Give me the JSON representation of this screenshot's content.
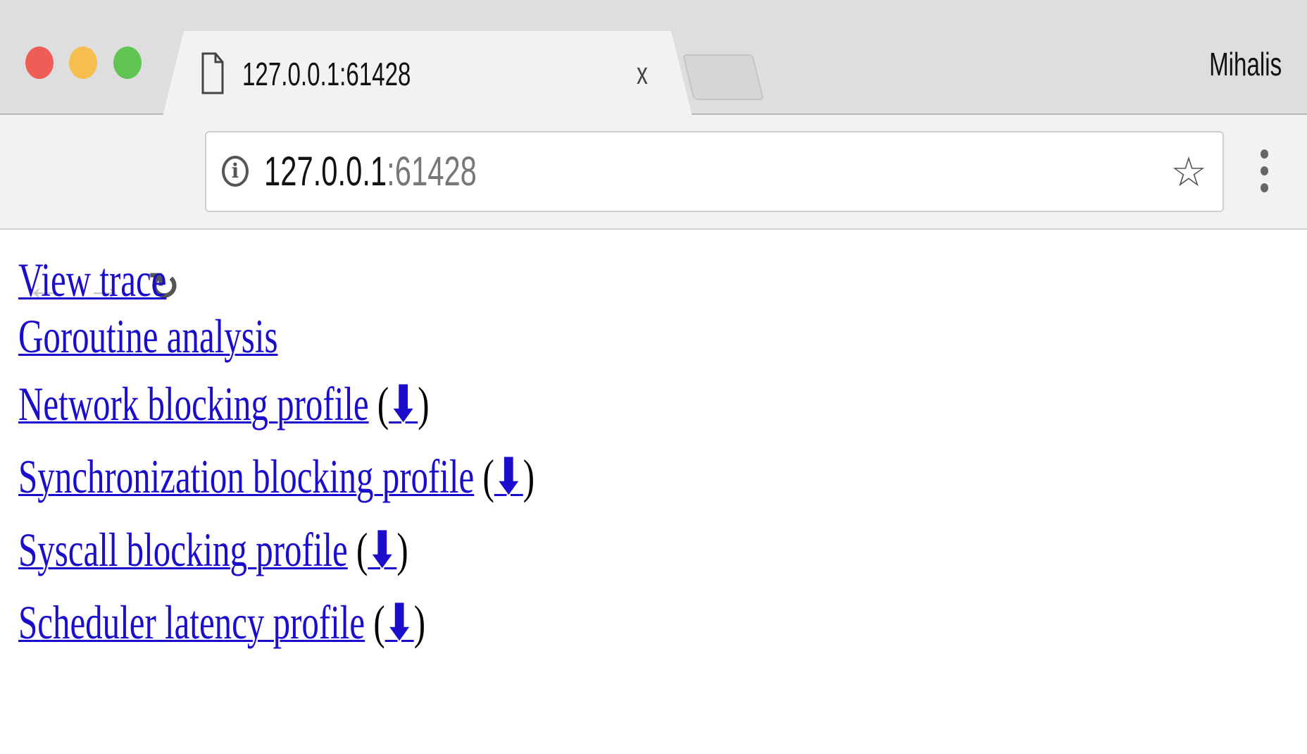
{
  "window": {
    "traffic_lights": {
      "close": "#ee5e57",
      "minimize": "#f6be4f",
      "maximize": "#5fc452"
    },
    "profile_name": "Mihalis"
  },
  "tab": {
    "title": "127.0.0.1:61428",
    "icon": "document-icon",
    "close_label": "x"
  },
  "toolbar": {
    "back_icon": "←",
    "forward_icon": "→",
    "reload_icon": "↻",
    "url_host": "127.0.0.1",
    "url_port": ":61428",
    "star_icon": "☆"
  },
  "links": [
    {
      "label": "View trace",
      "download": null
    },
    {
      "label": "Goroutine analysis",
      "download": null
    },
    {
      "label": "Network blocking profile",
      "download": "⬇"
    },
    {
      "label": "Synchronization blocking profile",
      "download": "⬇"
    },
    {
      "label": "Syscall blocking profile",
      "download": "⬇"
    },
    {
      "label": "Scheduler latency profile",
      "download": "⬇"
    }
  ],
  "colors": {
    "link": "#1a0dcc"
  }
}
